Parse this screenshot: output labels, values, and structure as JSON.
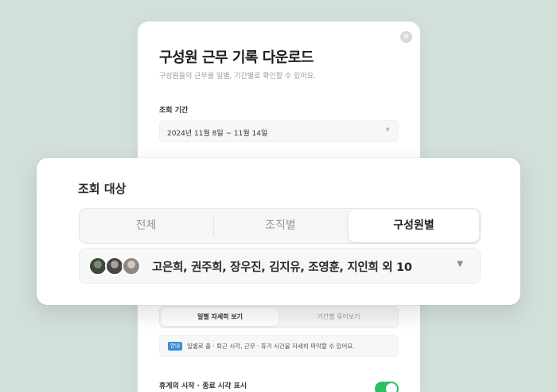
{
  "modal": {
    "title": "구성원 근무 기록 다운로드",
    "subtitle": "구성원들의 근무를 일별, 기간별로 확인할 수 있어요.",
    "close_icon": "close-icon",
    "period": {
      "label": "조회 기간",
      "value": "2024년 11월 8일 ~ 11월 14일"
    },
    "view_tabs": [
      {
        "label": "일별 자세히 보기",
        "active": true
      },
      {
        "label": "기간별 묶어보기",
        "active": false
      }
    ],
    "notice": {
      "badge": "안내",
      "text": "일별로 출 · 퇴근 시각, 근무 · 휴가 시간을 자세히 파악할 수 있어요."
    },
    "toggle": {
      "label": "휴게의 시작 · 종료 시각 표시",
      "on": true
    }
  },
  "target_card": {
    "title": "조회 대상",
    "tabs": [
      {
        "label": "전체",
        "active": false
      },
      {
        "label": "조직별",
        "active": false
      },
      {
        "label": "구성원별",
        "active": true
      }
    ],
    "selected_members": "고은희, 권주희, 장우진, 김지유, 조영훈, 지인희 외 10",
    "avatar_count": 3
  },
  "colors": {
    "background": "#d3e0da",
    "toggle_on": "#2bbf63",
    "notice_badge": "#3d8bd9"
  }
}
